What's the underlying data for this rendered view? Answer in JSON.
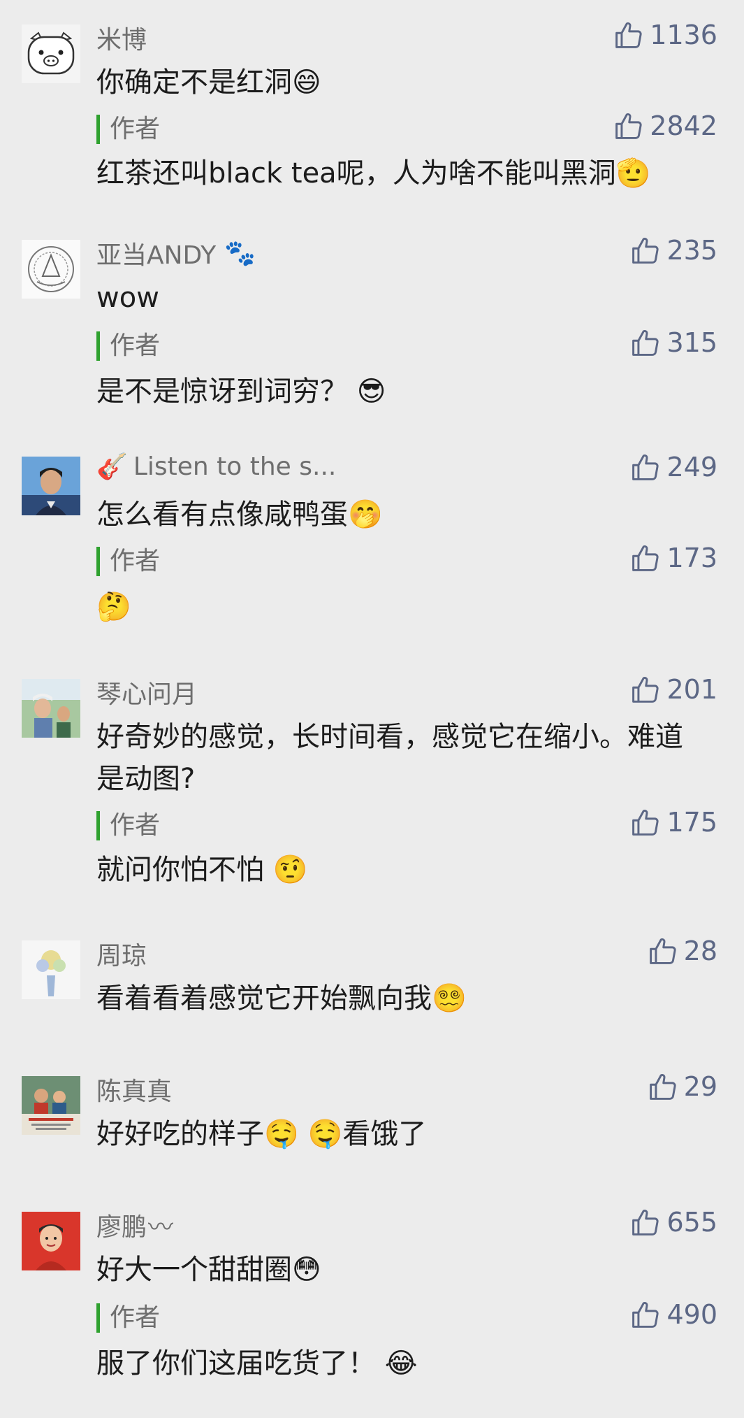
{
  "colors": {
    "background": "#ececec",
    "name_gray": "#6e6e6e",
    "like_blue_gray": "#5c6785",
    "author_bar_green": "#2fa12f"
  },
  "comments": [
    {
      "avatar": "pig-avatar-icon",
      "name": "米博",
      "name_post_icon": "",
      "name_pre_icon": "",
      "likes": "1136",
      "text": "你确定不是红洞",
      "text_emoji": "😄",
      "reply": {
        "label": "作者",
        "likes": "2842",
        "text": "红茶还叫black tea呢，人为啥不能叫黑洞",
        "emoji": "🫡"
      }
    },
    {
      "avatar": "emblem-avatar-icon",
      "name": "亚当ANDY",
      "name_post_icon": "🐾",
      "name_pre_icon": "",
      "likes": "235",
      "text": "wow",
      "text_emoji": "",
      "reply": {
        "label": "作者",
        "likes": "315",
        "text": "是不是惊讶到词穷？ ",
        "emoji": "😎"
      }
    },
    {
      "avatar": "man-photo-avatar-icon",
      "name": "Listen to the s...",
      "name_pre_icon": "🎸",
      "name_post_icon": "",
      "likes": "249",
      "text": "怎么看有点像咸鸭蛋",
      "text_emoji": "🤭",
      "reply": {
        "label": "作者",
        "likes": "173",
        "text": "",
        "emoji": "🤔"
      }
    },
    {
      "avatar": "people-photo-avatar-icon",
      "name": "琴心问月",
      "name_pre_icon": "",
      "name_post_icon": "",
      "likes": "201",
      "text": "好奇妙的感觉，长时间看，感觉它在缩小。难道是动图?",
      "text_emoji": "",
      "reply": {
        "label": "作者",
        "likes": "175",
        "text": "就问你怕不怕 ",
        "emoji": "🤨"
      }
    },
    {
      "avatar": "flower-avatar-icon",
      "name": "周琼",
      "name_pre_icon": "",
      "name_post_icon": "",
      "likes": "28",
      "text": "看着看着感觉它开始飘向我",
      "text_emoji": "😵‍💫",
      "reply": null
    },
    {
      "avatar": "family-photo-avatar-icon",
      "name": "陈真真",
      "name_pre_icon": "",
      "name_post_icon": "",
      "likes": "29",
      "text": "好好吃的样子",
      "text_emoji": "🤤 🤤看饿了",
      "reply": null
    },
    {
      "avatar": "red-cartoon-avatar-icon",
      "name": "廖鹏",
      "name_pre_icon": "",
      "name_post_icon": "〰",
      "likes": "655",
      "text": "好大一个甜甜圈",
      "text_emoji": "😳",
      "reply": {
        "label": "作者",
        "likes": "490",
        "text": "服了你们这届吃货了！ ",
        "emoji": "😂"
      }
    }
  ]
}
